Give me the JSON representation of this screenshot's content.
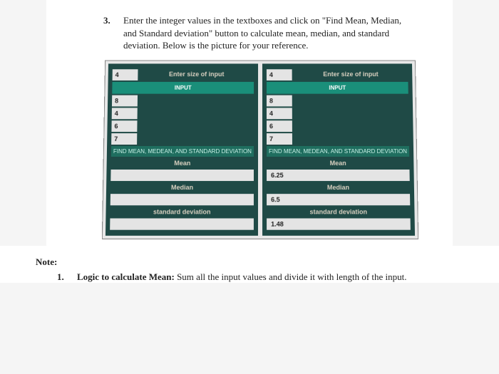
{
  "instruction": {
    "number": "3.",
    "text": "Enter the integer values in the textboxes and click on \"Find Mean, Median, and Standard deviation\" button to calculate mean, median, and standard deviation. Below is the picture for your reference."
  },
  "labels": {
    "enter_size": "Enter size of input",
    "input": "INPUT",
    "find_btn": "FIND MEAN, MEDEAN, AND STANDARD DEVIATION",
    "mean": "Mean",
    "median": "Median",
    "stddev": "standard deviation"
  },
  "left": {
    "size": "4",
    "values": [
      "8",
      "4",
      "6",
      "7"
    ],
    "mean": "",
    "median": "",
    "stddev": ""
  },
  "right": {
    "size": "4",
    "values": [
      "8",
      "4",
      "6",
      "7"
    ],
    "mean": "6.25",
    "median": "6.5",
    "stddev": "1.48"
  },
  "note": {
    "title": "Note:",
    "items": [
      {
        "num": "1.",
        "bold": "Logic to calculate Mean:",
        "rest": " Sum all the input values and divide it with length of the input."
      }
    ]
  }
}
